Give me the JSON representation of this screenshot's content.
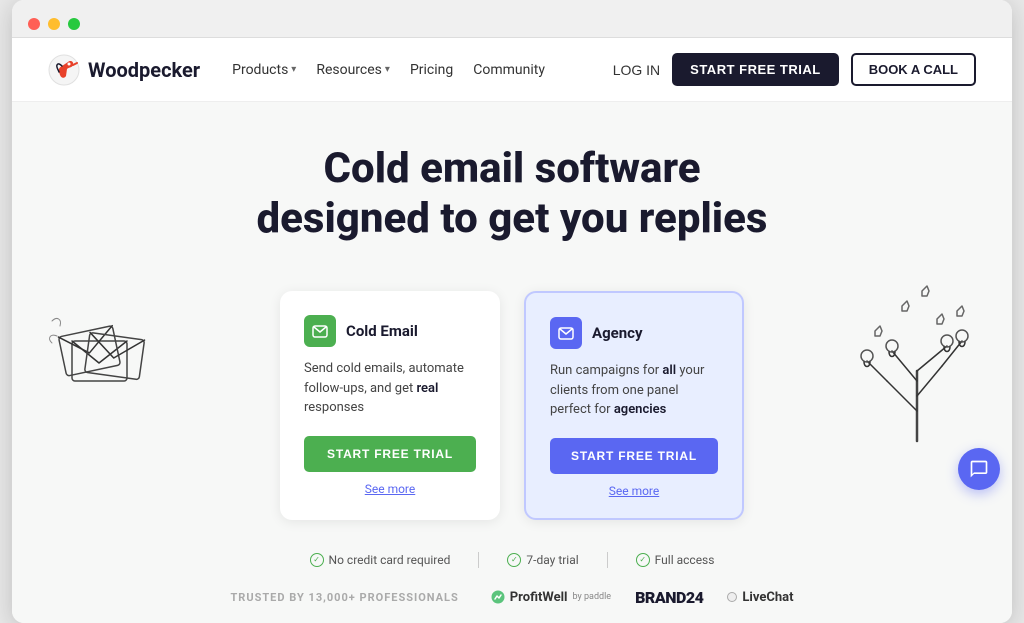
{
  "browser": {
    "dots": [
      "red",
      "yellow",
      "green"
    ]
  },
  "navbar": {
    "logo_text": "Woodpecker",
    "nav_items": [
      {
        "label": "Products",
        "has_dropdown": true
      },
      {
        "label": "Resources",
        "has_dropdown": true
      },
      {
        "label": "Pricing",
        "has_dropdown": false
      },
      {
        "label": "Community",
        "has_dropdown": false
      }
    ],
    "login_label": "LOG IN",
    "trial_label": "START FREE TRIAL",
    "book_label": "BOOK A CALL"
  },
  "hero": {
    "title_line1": "Cold email software",
    "title_line2": "designed to get you replies"
  },
  "cards": [
    {
      "id": "cold-email",
      "title": "Cold Email",
      "description": "Send cold emails, automate follow-ups, and get real responses",
      "btn_label": "START FREE TRIAL",
      "see_more_label": "See more",
      "style": "green"
    },
    {
      "id": "agency",
      "title": "Agency",
      "description": "Run campaigns for all your clients from one panel perfect for agencies",
      "btn_label": "START FREE TRIAL",
      "see_more_label": "See more",
      "style": "blue"
    }
  ],
  "trust": {
    "items": [
      {
        "icon": "check",
        "text": "No credit card required"
      },
      {
        "icon": "check",
        "text": "7-day trial"
      },
      {
        "icon": "check",
        "text": "Full access"
      }
    ]
  },
  "logos": {
    "trusted_text": "TRUSTED BY 13,000+ PROFESSIONALS",
    "brands": [
      {
        "name": "ProfitWell",
        "sub": "by paddle"
      },
      {
        "name": "BRAND24",
        "sub": ""
      },
      {
        "name": "LiveChat",
        "sub": ""
      }
    ]
  },
  "chat": {
    "label": "chat-icon"
  }
}
